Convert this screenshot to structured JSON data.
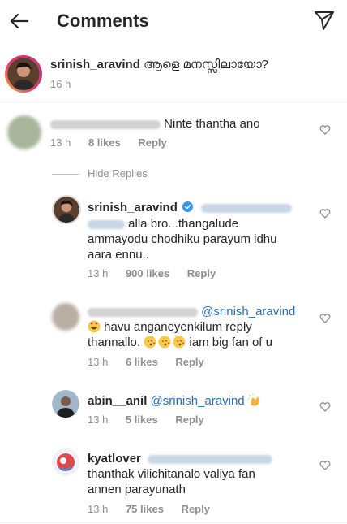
{
  "header": {
    "title": "Comments",
    "back_icon": "arrow-left-icon",
    "send_icon": "paper-plane-icon"
  },
  "caption": {
    "username": "srinish_aravind",
    "text": "ആളെ മനസ്സിലായോ?",
    "time": "16 h"
  },
  "comments": [
    {
      "text": "Ninte thantha ano",
      "time": "13 h",
      "likes": "8 likes",
      "reply": "Reply"
    }
  ],
  "hide_replies": "Hide Replies",
  "replies": [
    {
      "username": "srinish_aravind",
      "line1": "alla bro...thangalude",
      "line2": "ammayodu chodhiku parayum idhu",
      "line3": "aara ennu..",
      "time": "13 h",
      "likes": "900 likes",
      "reply": "Reply"
    },
    {
      "mention": "@srinish_aravind",
      "line1": "havu anganeyenkilum reply",
      "line2": "thannallo.",
      "line2b": "iam big fan of u",
      "time": "13 h",
      "likes": "6 likes",
      "reply": "Reply"
    },
    {
      "username": "abin__anil",
      "mention": "@srinish_aravind",
      "time": "13 h",
      "likes": "5 likes",
      "reply": "Reply"
    },
    {
      "username": "kyatlover",
      "line1": "thanthak vilichitanalo valiya fan",
      "line2": "annen parayunath",
      "time": "13 h",
      "likes": "75 likes",
      "reply": "Reply"
    }
  ],
  "colors": {
    "mention": "#2a6fb3",
    "meta": "#8e8e8e",
    "verified": "#3897f0"
  }
}
